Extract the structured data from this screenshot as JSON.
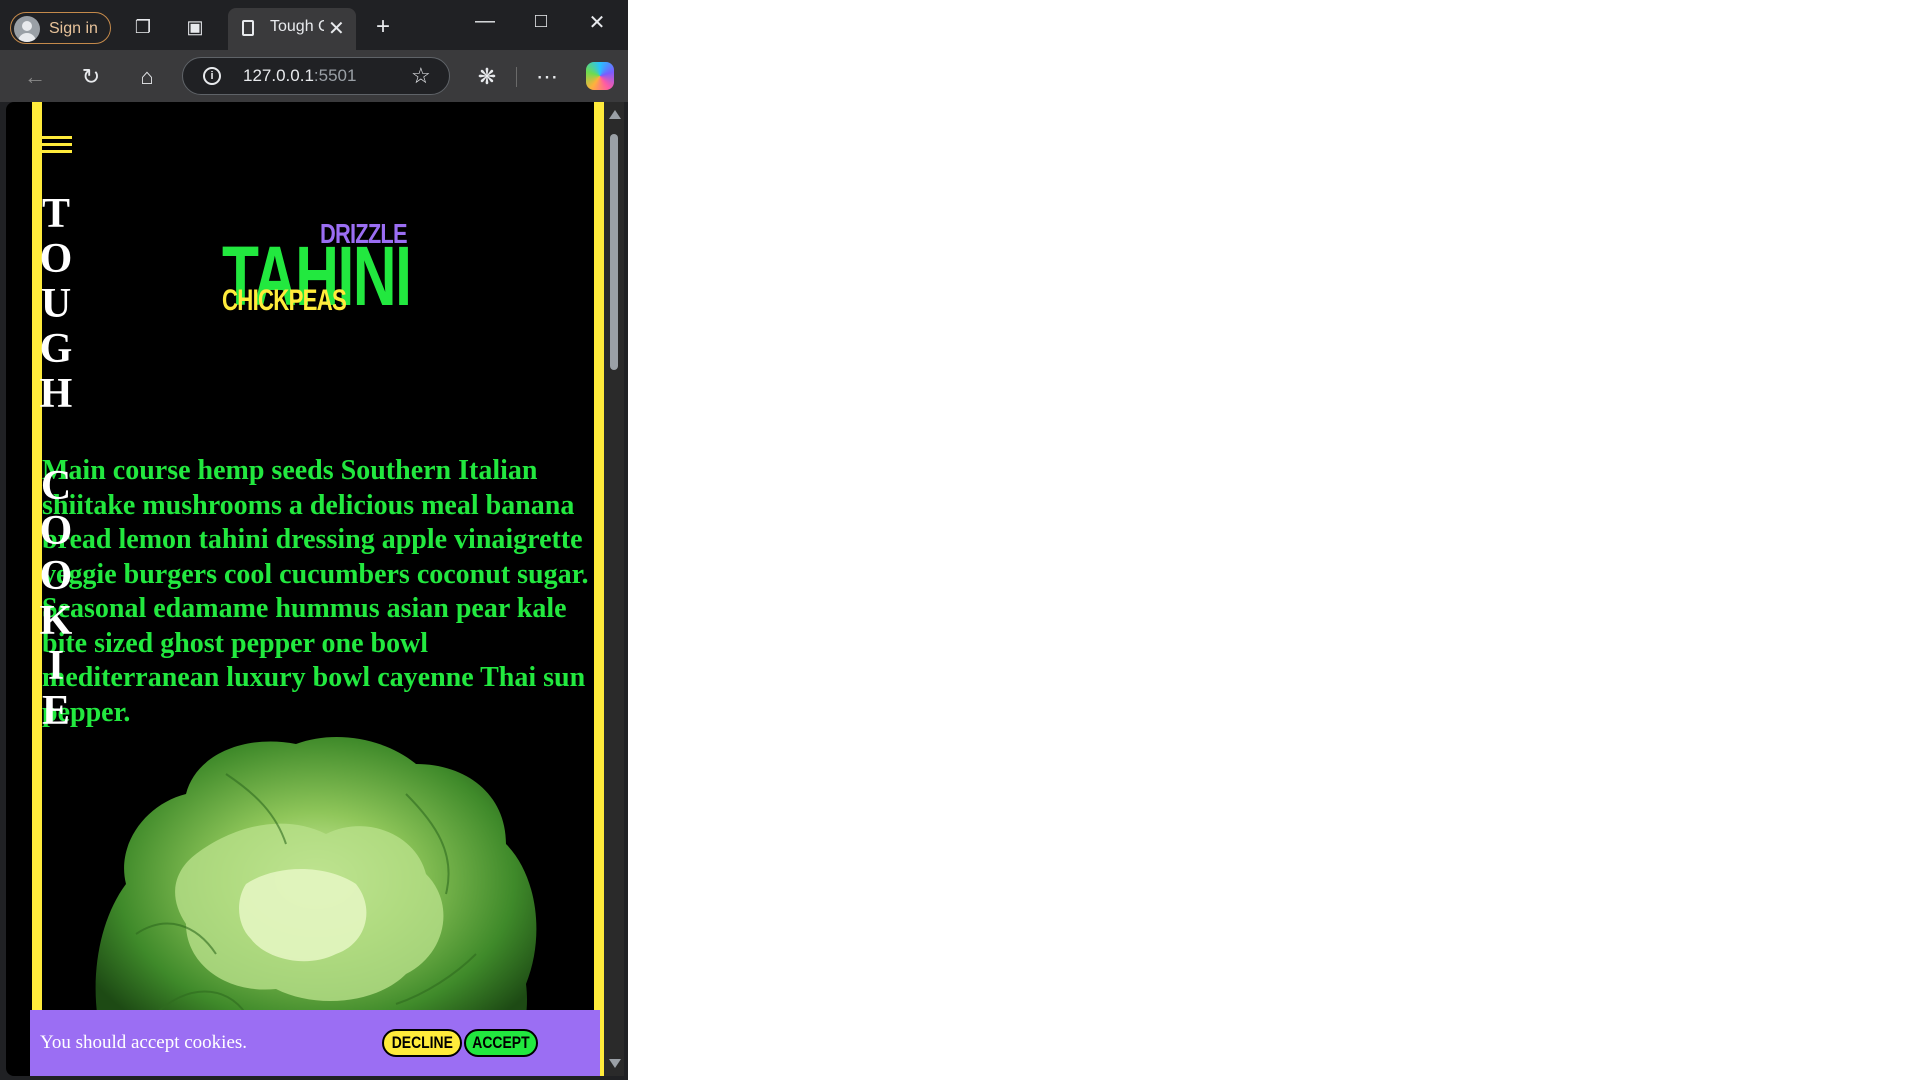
{
  "browser": {
    "signin_label": "Sign in",
    "tab_title": "Tough Cookie",
    "url_host": "127.0.0.1",
    "url_port": ":5501",
    "icons": [
      "workspaces-icon",
      "vertical-tabs-icon",
      "new-tab-icon",
      "minimize-icon",
      "maximize-icon",
      "close-window-icon",
      "back-icon",
      "refresh-icon",
      "home-icon",
      "site-info-icon",
      "favorite-star-icon",
      "extensions-icon",
      "more-menu-icon",
      "copilot-icon"
    ]
  },
  "page": {
    "brand_word1": "TOUGH",
    "brand_word2": "COOKIE",
    "logo": {
      "top": "DRIZZLE",
      "main": "TAHINI",
      "bottom": "CHICKPEAS"
    },
    "paragraph": "Main course hemp seeds Southern Italian shiitake mushrooms a delicious meal banana bread lemon tahini dressing apple vinaigrette veggie burgers cool cucumbers coconut sugar. Seasonal edamame hummus asian pear kale bite sized ghost pepper one bowl mediterranean luxury bowl cayenne Thai sun pepper.",
    "image_alt": "lettuce"
  },
  "cookie_banner": {
    "message": "You should accept cookies.",
    "decline_label": "DECLINE",
    "accept_label": "ACCEPT"
  },
  "colors": {
    "accent_yellow": "#ffeb3b",
    "accent_green": "#22e83f",
    "accent_purple": "#9b6ef3",
    "page_bg": "#000000"
  }
}
